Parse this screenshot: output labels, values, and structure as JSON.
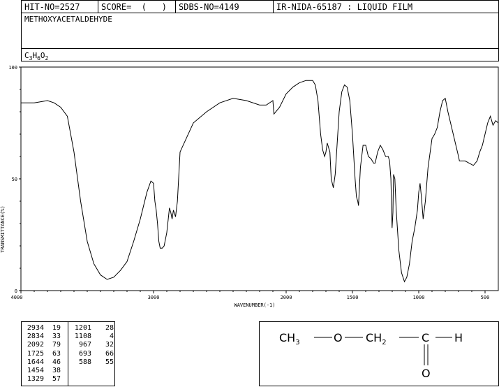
{
  "header": {
    "hit_no": "HIT-NO=2527",
    "score": "SCORE=  (   )",
    "sdbs_no": "SDBS-NO=4149",
    "ir_id": "IR-NIDA-65187 : LIQUID FILM"
  },
  "compound_name": "METHOXYACETALDEHYDE",
  "formula": {
    "c": "C",
    "c_n": "3",
    "h": "H",
    "h_n": "6",
    "o": "O",
    "o_n": "2"
  },
  "chart_data": {
    "type": "line",
    "xlabel": "WAVENUMBER(-1)",
    "ylabel": "TRANSMITTANCE(%)",
    "xlim": [
      4000,
      400
    ],
    "ylim": [
      0,
      100
    ],
    "x_ticks": [
      "4000",
      "3000",
      "2000",
      "1500",
      "1000",
      "500"
    ],
    "y_ticks": [
      "0",
      "50",
      "100"
    ],
    "series": [
      {
        "x": [
          4000,
          3900,
          3800,
          3750,
          3700,
          3650,
          3600,
          3550,
          3500,
          3450,
          3400,
          3350,
          3300,
          3250,
          3200,
          3150,
          3100,
          3050,
          3020,
          3000,
          2990,
          2980,
          2970,
          2960,
          2950,
          2934,
          2920,
          2900,
          2880,
          2870,
          2860,
          2850,
          2834,
          2820,
          2800,
          2700,
          2600,
          2500,
          2400,
          2300,
          2200,
          2150,
          2100,
          2092,
          2050,
          2000,
          1950,
          1900,
          1850,
          1800,
          1780,
          1760,
          1740,
          1725,
          1710,
          1700,
          1690,
          1670,
          1660,
          1644,
          1630,
          1600,
          1580,
          1560,
          1540,
          1520,
          1500,
          1480,
          1470,
          1460,
          1454,
          1440,
          1420,
          1400,
          1380,
          1360,
          1340,
          1329,
          1310,
          1290,
          1270,
          1250,
          1230,
          1220,
          1210,
          1201,
          1195,
          1190,
          1180,
          1170,
          1150,
          1130,
          1108,
          1090,
          1070,
          1050,
          1030,
          1010,
          1000,
          990,
          980,
          967,
          950,
          930,
          900,
          880,
          860,
          840,
          820,
          800,
          780,
          760,
          740,
          720,
          700,
          693,
          650,
          620,
          588,
          560,
          540,
          520,
          500,
          480,
          460,
          440,
          420,
          400
        ],
        "y": [
          84,
          84,
          85,
          84,
          82,
          78,
          62,
          40,
          22,
          12,
          7,
          5,
          6,
          9,
          13,
          22,
          32,
          44,
          49,
          48,
          40,
          36,
          30,
          22,
          19,
          19,
          20,
          26,
          37,
          35,
          32,
          36,
          33,
          40,
          62,
          75,
          80,
          84,
          86,
          85,
          83,
          83,
          85,
          79,
          82,
          88,
          91,
          93,
          94,
          94,
          92,
          85,
          70,
          63,
          60,
          62,
          66,
          62,
          50,
          46,
          52,
          80,
          89,
          92,
          91,
          85,
          70,
          50,
          42,
          40,
          38,
          55,
          65,
          65,
          60,
          59,
          57,
          57,
          62,
          65,
          63,
          60,
          60,
          58,
          50,
          28,
          35,
          52,
          50,
          36,
          18,
          8,
          4,
          6,
          12,
          22,
          28,
          36,
          44,
          48,
          42,
          32,
          40,
          55,
          68,
          70,
          73,
          80,
          85,
          86,
          80,
          75,
          70,
          65,
          60,
          58,
          58,
          57,
          56,
          58,
          62,
          65,
          70,
          75,
          78,
          74,
          76,
          75
        ]
      }
    ]
  },
  "peak_table": [
    [
      "2934",
      "19",
      "1201",
      "28"
    ],
    [
      "2834",
      "33",
      "1108",
      "4"
    ],
    [
      "2092",
      "79",
      "967",
      "32"
    ],
    [
      "1725",
      "63",
      "693",
      "66"
    ],
    [
      "1644",
      "46",
      "588",
      "55"
    ],
    [
      "1454",
      "38",
      "",
      ""
    ],
    [
      "1329",
      "57",
      "",
      ""
    ]
  ],
  "structure": {
    "ch3": "CH",
    "ch3_sub": "3",
    "o1": "O",
    "ch2": "CH",
    "ch2_sub": "2",
    "c": "C",
    "h": "H",
    "o2": "O"
  }
}
